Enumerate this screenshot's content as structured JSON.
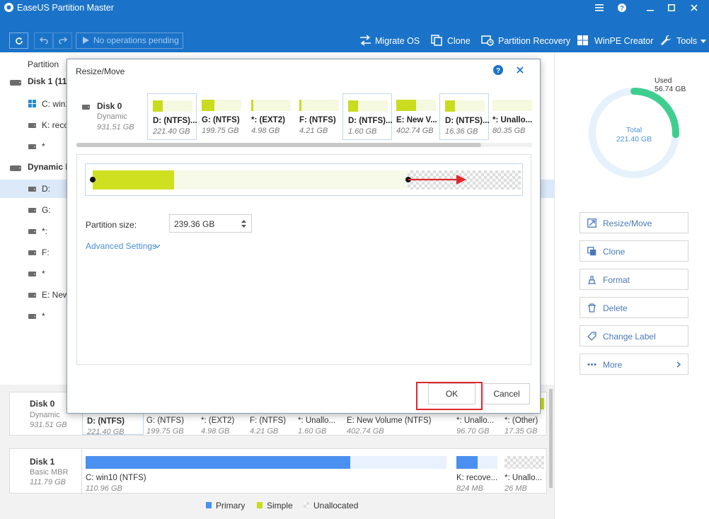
{
  "window": {
    "title": "EaseUS Partition Master"
  },
  "toolbar": {
    "pending": "No operations pending",
    "items": [
      {
        "label": "Migrate OS",
        "icon": "migrate-icon"
      },
      {
        "label": "Clone",
        "icon": "clone-icon"
      },
      {
        "label": "Partition Recovery",
        "icon": "recovery-icon"
      },
      {
        "label": "WinPE Creator",
        "icon": "windows-icon"
      },
      {
        "label": "Tools",
        "icon": "wrench-icon"
      }
    ]
  },
  "tree": {
    "header": "Partition",
    "disk1": "Disk 1 (11",
    "disk1_items": [
      "C: win1",
      "K: reco",
      "*"
    ],
    "dynamic": "Dynamic D",
    "dynamic_items": [
      "D:",
      "G:",
      "*:",
      "F:",
      "*",
      "E: New",
      "*"
    ]
  },
  "usage": {
    "used_label": "Used",
    "used_value": "56.74 GB",
    "total_label": "Total",
    "total_value": "221.40 GB",
    "used_fraction": 0.256
  },
  "actions": [
    {
      "label": "Resize/Move",
      "icon": "resize-icon"
    },
    {
      "label": "Clone",
      "icon": "clone-icon"
    },
    {
      "label": "Format",
      "icon": "format-icon"
    },
    {
      "label": "Delete",
      "icon": "trash-icon"
    },
    {
      "label": "Change Label",
      "icon": "label-icon"
    },
    {
      "label": "More",
      "icon": "more-icon"
    }
  ],
  "disk0_map": {
    "name": "Disk 0",
    "type": "Dynamic",
    "size": "931.51 GB",
    "segments": [
      {
        "label": "D: (NTFS)",
        "size": "221.40 GB"
      },
      {
        "label": "G: (NTFS)",
        "size": "199.75 GB"
      },
      {
        "label": "*: (EXT2)",
        "size": "4.98 GB"
      },
      {
        "label": "F: (NTFS)",
        "size": "4.21 GB"
      },
      {
        "label": "*: Unallo...",
        "size": "1.60 GB"
      },
      {
        "label": "E: New Volume (NTFS)",
        "size": "402.74 GB"
      },
      {
        "label": "*: Unallo...",
        "size": "96.70 GB"
      },
      {
        "label": "*: (Other)",
        "size": "17.35 GB"
      }
    ]
  },
  "disk1_map": {
    "name": "Disk 1",
    "type": "Basic MBR",
    "size": "111.79 GB",
    "segments": [
      {
        "label": "C: win10 (NTFS)",
        "size": "110.96 GB"
      },
      {
        "label": "K: recove...",
        "size": "824 MB"
      },
      {
        "label": "*: Unallo...",
        "size": "26 MB"
      }
    ]
  },
  "legend": [
    "Primary",
    "Simple",
    "Unallocated"
  ],
  "colors": {
    "primary": "#4a90f0",
    "simple": "#c9dc1e",
    "accent": "#1a73c8",
    "highlight": "#e0282f"
  },
  "dialog": {
    "title": "Resize/Move",
    "disk": {
      "name": "Disk 0",
      "type": "Dynamic",
      "size": "931.51 GB"
    },
    "partitions": [
      {
        "label": "D: (NTFS)...",
        "size": "221.40 GB",
        "fill": 0.25
      },
      {
        "label": "G: (NTFS)",
        "size": "199.75 GB",
        "fill": 0.33
      },
      {
        "label": "*: (EXT2)",
        "size": "4.98 GB",
        "fill": 0.03
      },
      {
        "label": "F: (NTFS)",
        "size": "4.21 GB",
        "fill": 0.03
      },
      {
        "label": "D: (NTFS)...",
        "size": "1.60 GB",
        "fill": 0.25
      },
      {
        "label": "E: New V...",
        "size": "402.74 GB",
        "fill": 0.5
      },
      {
        "label": "D: (NTFS)...",
        "size": "16.36 GB",
        "fill": 0.25
      },
      {
        "label": "*: Unallo...",
        "size": "80.35 GB",
        "fill": 0
      }
    ],
    "partition_size_label": "Partition size:",
    "partition_size_value": "239.36 GB",
    "advanced": "Advanced Settings",
    "ok": "OK",
    "cancel": "Cancel"
  }
}
